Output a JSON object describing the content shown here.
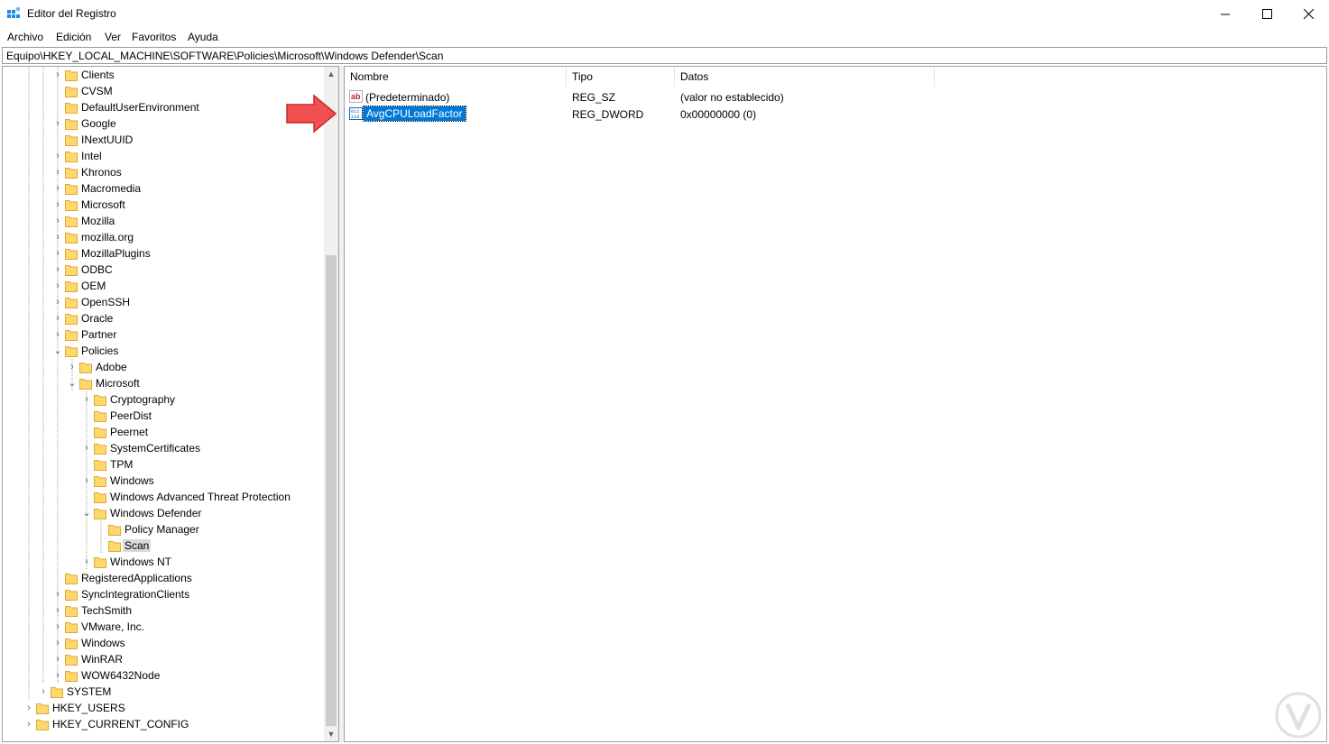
{
  "window": {
    "title": "Editor del Registro"
  },
  "menu": [
    "Archivo",
    "Edición",
    "Ver",
    "Favoritos",
    "Ayuda"
  ],
  "address": "Equipo\\HKEY_LOCAL_MACHINE\\SOFTWARE\\Policies\\Microsoft\\Windows Defender\\Scan",
  "tree": [
    {
      "label": "Clients",
      "expander": "collapsed",
      "indent": 2
    },
    {
      "label": "CVSM",
      "expander": "none",
      "indent": 2
    },
    {
      "label": "DefaultUserEnvironment",
      "expander": "none",
      "indent": 2
    },
    {
      "label": "Google",
      "expander": "collapsed",
      "indent": 2
    },
    {
      "label": "INextUUID",
      "expander": "none",
      "indent": 2
    },
    {
      "label": "Intel",
      "expander": "collapsed",
      "indent": 2
    },
    {
      "label": "Khronos",
      "expander": "collapsed",
      "indent": 2
    },
    {
      "label": "Macromedia",
      "expander": "collapsed",
      "indent": 2
    },
    {
      "label": "Microsoft",
      "expander": "collapsed",
      "indent": 2
    },
    {
      "label": "Mozilla",
      "expander": "collapsed",
      "indent": 2
    },
    {
      "label": "mozilla.org",
      "expander": "collapsed",
      "indent": 2
    },
    {
      "label": "MozillaPlugins",
      "expander": "collapsed",
      "indent": 2
    },
    {
      "label": "ODBC",
      "expander": "collapsed",
      "indent": 2
    },
    {
      "label": "OEM",
      "expander": "collapsed",
      "indent": 2
    },
    {
      "label": "OpenSSH",
      "expander": "collapsed",
      "indent": 2
    },
    {
      "label": "Oracle",
      "expander": "collapsed",
      "indent": 2
    },
    {
      "label": "Partner",
      "expander": "collapsed",
      "indent": 2
    },
    {
      "label": "Policies",
      "expander": "expanded",
      "indent": 2
    },
    {
      "label": "Adobe",
      "expander": "collapsed",
      "indent": 3
    },
    {
      "label": "Microsoft",
      "expander": "expanded",
      "indent": 3
    },
    {
      "label": "Cryptography",
      "expander": "collapsed",
      "indent": 4
    },
    {
      "label": "PeerDist",
      "expander": "none",
      "indent": 4
    },
    {
      "label": "Peernet",
      "expander": "none",
      "indent": 4
    },
    {
      "label": "SystemCertificates",
      "expander": "collapsed",
      "indent": 4
    },
    {
      "label": "TPM",
      "expander": "none",
      "indent": 4
    },
    {
      "label": "Windows",
      "expander": "collapsed",
      "indent": 4
    },
    {
      "label": "Windows Advanced Threat Protection",
      "expander": "none",
      "indent": 4
    },
    {
      "label": "Windows Defender",
      "expander": "expanded",
      "indent": 4
    },
    {
      "label": "Policy Manager",
      "expander": "none",
      "indent": 5
    },
    {
      "label": "Scan",
      "expander": "none",
      "indent": 5,
      "selected": true
    },
    {
      "label": "Windows NT",
      "expander": "collapsed",
      "indent": 4
    },
    {
      "label": "RegisteredApplications",
      "expander": "none",
      "indent": 2
    },
    {
      "label": "SyncIntegrationClients",
      "expander": "collapsed",
      "indent": 2
    },
    {
      "label": "TechSmith",
      "expander": "collapsed",
      "indent": 2
    },
    {
      "label": "VMware, Inc.",
      "expander": "collapsed",
      "indent": 2
    },
    {
      "label": "Windows",
      "expander": "collapsed",
      "indent": 2
    },
    {
      "label": "WinRAR",
      "expander": "collapsed",
      "indent": 2
    },
    {
      "label": "WOW6432Node",
      "expander": "collapsed",
      "indent": 2
    },
    {
      "label": "SYSTEM",
      "expander": "collapsed",
      "indent": 1
    },
    {
      "label": "HKEY_USERS",
      "expander": "collapsed",
      "indent": 0
    },
    {
      "label": "HKEY_CURRENT_CONFIG",
      "expander": "collapsed",
      "indent": 0
    }
  ],
  "list": {
    "columns": [
      "Nombre",
      "Tipo",
      "Datos"
    ],
    "rows": [
      {
        "name": "(Predeterminado)",
        "type": "REG_SZ",
        "data": "(valor no establecido)",
        "icon": "string-value-icon",
        "selected": false
      },
      {
        "name": "AvgCPULoadFactor",
        "type": "REG_DWORD",
        "data": "0x00000000 (0)",
        "icon": "dword-value-icon",
        "selected": true
      }
    ]
  },
  "colors": {
    "selection": "#0078d7",
    "arrow": "#e53935",
    "folder": "#ffd86b"
  }
}
